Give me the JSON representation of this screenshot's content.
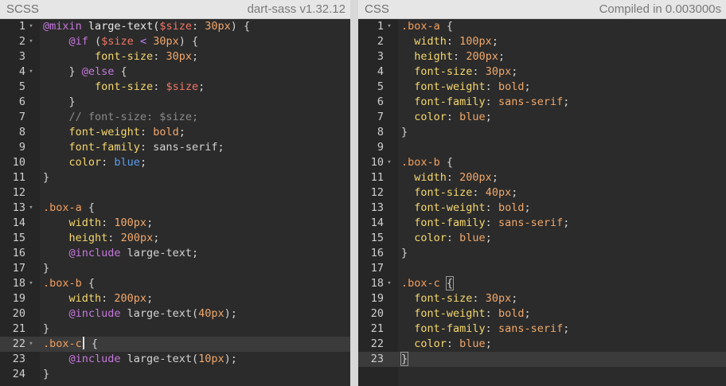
{
  "left": {
    "label": "SCSS",
    "meta": "dart-sass v1.32.12",
    "lines": [
      {
        "n": "1",
        "fold": true,
        "tokens": [
          [
            "t-at",
            "@mixin"
          ],
          [
            "t-p",
            " "
          ],
          [
            "t-fn",
            "large-text("
          ],
          [
            "t-var",
            "$size"
          ],
          [
            "t-p",
            ": "
          ],
          [
            "t-num",
            "30px"
          ],
          [
            "t-p",
            ") {"
          ]
        ]
      },
      {
        "n": "2",
        "fold": true,
        "tokens": [
          [
            "t-p",
            "    "
          ],
          [
            "t-at",
            "@if"
          ],
          [
            "t-p",
            " ("
          ],
          [
            "t-var",
            "$size"
          ],
          [
            "t-p",
            " "
          ],
          [
            "t-op",
            "<"
          ],
          [
            "t-p",
            " "
          ],
          [
            "t-num",
            "30px"
          ],
          [
            "t-p",
            ") {"
          ]
        ]
      },
      {
        "n": "3",
        "tokens": [
          [
            "t-p",
            "        "
          ],
          [
            "t-pr",
            "font-size"
          ],
          [
            "t-p",
            ": "
          ],
          [
            "t-num",
            "30px"
          ],
          [
            "t-p",
            ";"
          ]
        ]
      },
      {
        "n": "4",
        "fold": true,
        "tokens": [
          [
            "t-p",
            "    } "
          ],
          [
            "t-at",
            "@else"
          ],
          [
            "t-p",
            " {"
          ]
        ]
      },
      {
        "n": "5",
        "tokens": [
          [
            "t-p",
            "        "
          ],
          [
            "t-pr",
            "font-size"
          ],
          [
            "t-p",
            ": "
          ],
          [
            "t-var",
            "$size"
          ],
          [
            "t-p",
            ";"
          ]
        ]
      },
      {
        "n": "6",
        "tokens": [
          [
            "t-p",
            "    }"
          ]
        ]
      },
      {
        "n": "7",
        "tokens": [
          [
            "t-p",
            "    "
          ],
          [
            "t-cm",
            "// font-size: $size;"
          ]
        ]
      },
      {
        "n": "8",
        "tokens": [
          [
            "t-p",
            "    "
          ],
          [
            "t-pr",
            "font-weight"
          ],
          [
            "t-p",
            ": "
          ],
          [
            "t-val",
            "bold"
          ],
          [
            "t-p",
            ";"
          ]
        ]
      },
      {
        "n": "9",
        "tokens": [
          [
            "t-p",
            "    "
          ],
          [
            "t-pr",
            "font-family"
          ],
          [
            "t-p",
            ": sans-serif;"
          ]
        ]
      },
      {
        "n": "10",
        "tokens": [
          [
            "t-p",
            "    "
          ],
          [
            "t-pr",
            "color"
          ],
          [
            "t-p",
            ": "
          ],
          [
            "t-kw",
            "blue"
          ],
          [
            "t-p",
            ";"
          ]
        ]
      },
      {
        "n": "11",
        "tokens": [
          [
            "t-p",
            "}"
          ]
        ]
      },
      {
        "n": "12",
        "tokens": []
      },
      {
        "n": "13",
        "fold": true,
        "tokens": [
          [
            "t-sel",
            ".box-a"
          ],
          [
            "t-p",
            " {"
          ]
        ]
      },
      {
        "n": "14",
        "tokens": [
          [
            "t-p",
            "    "
          ],
          [
            "t-pr",
            "width"
          ],
          [
            "t-p",
            ": "
          ],
          [
            "t-num",
            "100px"
          ],
          [
            "t-p",
            ";"
          ]
        ]
      },
      {
        "n": "15",
        "tokens": [
          [
            "t-p",
            "    "
          ],
          [
            "t-pr",
            "height"
          ],
          [
            "t-p",
            ": "
          ],
          [
            "t-num",
            "200px"
          ],
          [
            "t-p",
            ";"
          ]
        ]
      },
      {
        "n": "16",
        "tokens": [
          [
            "t-p",
            "    "
          ],
          [
            "t-at",
            "@include"
          ],
          [
            "t-p",
            " large-text;"
          ]
        ]
      },
      {
        "n": "17",
        "tokens": [
          [
            "t-p",
            "}"
          ]
        ]
      },
      {
        "n": "18",
        "fold": true,
        "tokens": [
          [
            "t-sel",
            ".box-b"
          ],
          [
            "t-p",
            " {"
          ]
        ]
      },
      {
        "n": "19",
        "tokens": [
          [
            "t-p",
            "    "
          ],
          [
            "t-pr",
            "width"
          ],
          [
            "t-p",
            ": "
          ],
          [
            "t-num",
            "200px"
          ],
          [
            "t-p",
            ";"
          ]
        ]
      },
      {
        "n": "20",
        "tokens": [
          [
            "t-p",
            "    "
          ],
          [
            "t-at",
            "@include"
          ],
          [
            "t-p",
            " large-text("
          ],
          [
            "t-num",
            "40px"
          ],
          [
            "t-p",
            ");"
          ]
        ]
      },
      {
        "n": "21",
        "tokens": [
          [
            "t-p",
            "}"
          ]
        ]
      },
      {
        "n": "22",
        "fold": true,
        "active": true,
        "cursorAfter": 0,
        "tokens": [
          [
            "t-sel",
            ".box-c"
          ],
          [
            "cursor",
            ""
          ],
          [
            "t-p",
            " {"
          ]
        ]
      },
      {
        "n": "23",
        "tokens": [
          [
            "t-p",
            "    "
          ],
          [
            "t-at",
            "@include"
          ],
          [
            "t-p",
            " large-text("
          ],
          [
            "t-num",
            "10px"
          ],
          [
            "t-p",
            ");"
          ]
        ]
      },
      {
        "n": "24",
        "tokens": [
          [
            "t-p",
            "}"
          ]
        ]
      }
    ]
  },
  "right": {
    "label": "CSS",
    "meta": "Compiled in 0.003000s",
    "lines": [
      {
        "n": "1",
        "fold": true,
        "tokens": [
          [
            "t-sel",
            ".box-a"
          ],
          [
            "t-p",
            " {"
          ]
        ]
      },
      {
        "n": "2",
        "tokens": [
          [
            "t-p",
            "  "
          ],
          [
            "t-pr",
            "width"
          ],
          [
            "t-p",
            ": "
          ],
          [
            "t-num",
            "100px"
          ],
          [
            "t-p",
            ";"
          ]
        ]
      },
      {
        "n": "3",
        "tokens": [
          [
            "t-p",
            "  "
          ],
          [
            "t-pr",
            "height"
          ],
          [
            "t-p",
            ": "
          ],
          [
            "t-num",
            "200px"
          ],
          [
            "t-p",
            ";"
          ]
        ]
      },
      {
        "n": "4",
        "tokens": [
          [
            "t-p",
            "  "
          ],
          [
            "t-pr",
            "font-size"
          ],
          [
            "t-p",
            ": "
          ],
          [
            "t-num",
            "30px"
          ],
          [
            "t-p",
            ";"
          ]
        ]
      },
      {
        "n": "5",
        "tokens": [
          [
            "t-p",
            "  "
          ],
          [
            "t-pr",
            "font-weight"
          ],
          [
            "t-p",
            ": "
          ],
          [
            "t-val",
            "bold"
          ],
          [
            "t-p",
            ";"
          ]
        ]
      },
      {
        "n": "6",
        "tokens": [
          [
            "t-p",
            "  "
          ],
          [
            "t-pr",
            "font-family"
          ],
          [
            "t-p",
            ": "
          ],
          [
            "t-val",
            "sans-serif"
          ],
          [
            "t-p",
            ";"
          ]
        ]
      },
      {
        "n": "7",
        "tokens": [
          [
            "t-p",
            "  "
          ],
          [
            "t-pr",
            "color"
          ],
          [
            "t-p",
            ": "
          ],
          [
            "t-val",
            "blue"
          ],
          [
            "t-p",
            ";"
          ]
        ]
      },
      {
        "n": "8",
        "tokens": [
          [
            "t-p",
            "}"
          ]
        ]
      },
      {
        "n": "9",
        "tokens": []
      },
      {
        "n": "10",
        "fold": true,
        "tokens": [
          [
            "t-sel",
            ".box-b"
          ],
          [
            "t-p",
            " {"
          ]
        ]
      },
      {
        "n": "11",
        "tokens": [
          [
            "t-p",
            "  "
          ],
          [
            "t-pr",
            "width"
          ],
          [
            "t-p",
            ": "
          ],
          [
            "t-num",
            "200px"
          ],
          [
            "t-p",
            ";"
          ]
        ]
      },
      {
        "n": "12",
        "tokens": [
          [
            "t-p",
            "  "
          ],
          [
            "t-pr",
            "font-size"
          ],
          [
            "t-p",
            ": "
          ],
          [
            "t-num",
            "40px"
          ],
          [
            "t-p",
            ";"
          ]
        ]
      },
      {
        "n": "13",
        "tokens": [
          [
            "t-p",
            "  "
          ],
          [
            "t-pr",
            "font-weight"
          ],
          [
            "t-p",
            ": "
          ],
          [
            "t-val",
            "bold"
          ],
          [
            "t-p",
            ";"
          ]
        ]
      },
      {
        "n": "14",
        "tokens": [
          [
            "t-p",
            "  "
          ],
          [
            "t-pr",
            "font-family"
          ],
          [
            "t-p",
            ": "
          ],
          [
            "t-val",
            "sans-serif"
          ],
          [
            "t-p",
            ";"
          ]
        ]
      },
      {
        "n": "15",
        "tokens": [
          [
            "t-p",
            "  "
          ],
          [
            "t-pr",
            "color"
          ],
          [
            "t-p",
            ": "
          ],
          [
            "t-val",
            "blue"
          ],
          [
            "t-p",
            ";"
          ]
        ]
      },
      {
        "n": "16",
        "tokens": [
          [
            "t-p",
            "}"
          ]
        ]
      },
      {
        "n": "17",
        "tokens": []
      },
      {
        "n": "18",
        "fold": true,
        "tokens": [
          [
            "t-sel",
            ".box-c"
          ],
          [
            "t-p",
            " "
          ],
          [
            "bracket",
            "{"
          ]
        ]
      },
      {
        "n": "19",
        "tokens": [
          [
            "t-p",
            "  "
          ],
          [
            "t-pr",
            "font-size"
          ],
          [
            "t-p",
            ": "
          ],
          [
            "t-num",
            "30px"
          ],
          [
            "t-p",
            ";"
          ]
        ]
      },
      {
        "n": "20",
        "tokens": [
          [
            "t-p",
            "  "
          ],
          [
            "t-pr",
            "font-weight"
          ],
          [
            "t-p",
            ": "
          ],
          [
            "t-val",
            "bold"
          ],
          [
            "t-p",
            ";"
          ]
        ]
      },
      {
        "n": "21",
        "tokens": [
          [
            "t-p",
            "  "
          ],
          [
            "t-pr",
            "font-family"
          ],
          [
            "t-p",
            ": "
          ],
          [
            "t-val",
            "sans-serif"
          ],
          [
            "t-p",
            ";"
          ]
        ]
      },
      {
        "n": "22",
        "tokens": [
          [
            "t-p",
            "  "
          ],
          [
            "t-pr",
            "color"
          ],
          [
            "t-p",
            ": "
          ],
          [
            "t-val",
            "blue"
          ],
          [
            "t-p",
            ";"
          ]
        ]
      },
      {
        "n": "23",
        "active": true,
        "tokens": [
          [
            "bracket",
            "}"
          ]
        ]
      }
    ]
  },
  "icons": {
    "fold": "chevron-down-icon"
  },
  "colors": {
    "header_bg": "#e6e6e6",
    "editor_bg": "#2b2b2b",
    "active_line": "#3b3b3b",
    "selector": "#f29f5f",
    "property": "#f5d76e",
    "number": "#f2a86b",
    "at_rule": "#c678dd",
    "keyword_blue": "#5b9ef0"
  }
}
